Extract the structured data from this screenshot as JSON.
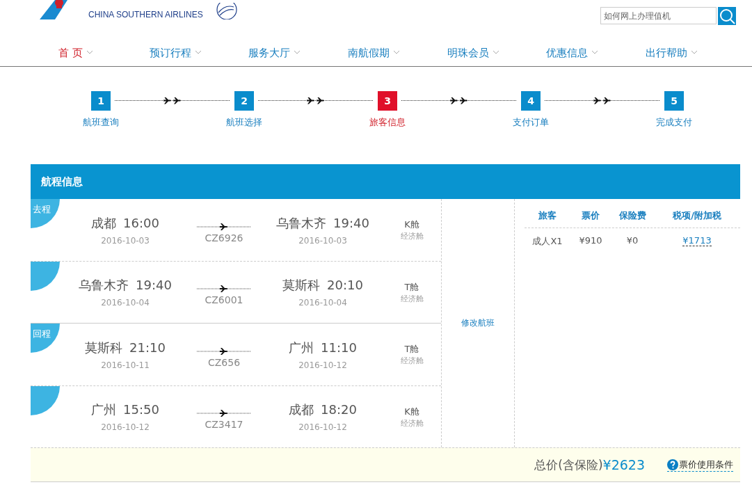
{
  "logo": {
    "name_en": "CHINA SOUTHERN AIRLINES"
  },
  "search": {
    "placeholder": "如何网上办理值机"
  },
  "nav": [
    {
      "label": "首 页",
      "selected": true
    },
    {
      "label": "预订行程",
      "selected": false
    },
    {
      "label": "服务大厅",
      "selected": false
    },
    {
      "label": "南航假期",
      "selected": false
    },
    {
      "label": "明珠会员",
      "selected": false
    },
    {
      "label": "优惠信息",
      "selected": false
    },
    {
      "label": "出行帮助",
      "selected": false
    }
  ],
  "steps": [
    {
      "number": "1",
      "label": "航班查询",
      "selected": false
    },
    {
      "number": "2",
      "label": "航班选择",
      "selected": false
    },
    {
      "number": "3",
      "label": "旅客信息",
      "selected": true
    },
    {
      "number": "4",
      "label": "支付订单",
      "selected": false
    },
    {
      "number": "5",
      "label": "完成支付",
      "selected": false
    }
  ],
  "panel": {
    "title": "航程信息"
  },
  "trips": [
    {
      "label": "去程",
      "segments": [
        {
          "dep_city": "成都",
          "dep_time": "16:00",
          "dep_date": "2016-10-03",
          "flight": "CZ6926",
          "arr_city": "乌鲁木齐",
          "arr_time": "19:40",
          "arr_date": "2016-10-03",
          "cabin": "K舱",
          "cabin_class": "经济舱"
        },
        {
          "dep_city": "乌鲁木齐",
          "dep_time": "19:40",
          "dep_date": "2016-10-04",
          "flight": "CZ6001",
          "arr_city": "莫斯科",
          "arr_time": "20:10",
          "arr_date": "2016-10-04",
          "cabin": "T舱",
          "cabin_class": "经济舱"
        }
      ]
    },
    {
      "label": "回程",
      "segments": [
        {
          "dep_city": "莫斯科",
          "dep_time": "21:10",
          "dep_date": "2016-10-11",
          "flight": "CZ656",
          "arr_city": "广州",
          "arr_time": "11:10",
          "arr_date": "2016-10-12",
          "cabin": "T舱",
          "cabin_class": "经济舱"
        },
        {
          "dep_city": "广州",
          "dep_time": "15:50",
          "dep_date": "2016-10-12",
          "flight": "CZ3417",
          "arr_city": "成都",
          "arr_time": "18:20",
          "arr_date": "2016-10-12",
          "cabin": "K舱",
          "cabin_class": "经济舱"
        }
      ]
    }
  ],
  "modify_link": "修改航班",
  "price_table": {
    "columns": [
      "旅客",
      "票价",
      "保险费",
      "税项/附加税"
    ],
    "rows": [
      {
        "cells": [
          {
            "text": "成人X1",
            "link": false
          },
          {
            "text": "¥910",
            "link": false
          },
          {
            "text": "¥0",
            "link": false
          },
          {
            "text": "¥1713",
            "link": true
          }
        ]
      }
    ]
  },
  "total": {
    "label": "总价(含保险)",
    "amount": "¥2623"
  },
  "conditions_link": "票价使用条件"
}
